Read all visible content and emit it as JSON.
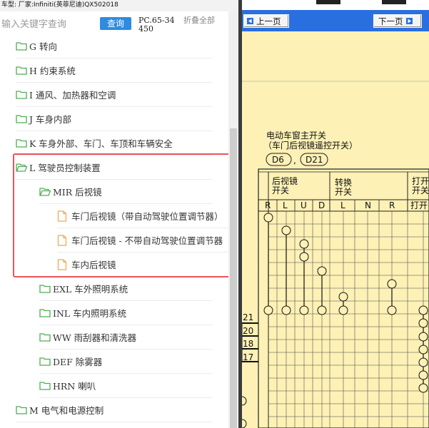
{
  "top_info": "车型:  厂家:Infiniti(英菲尼迪)QX502018",
  "search": {
    "placeholder": "输入关键字查询",
    "button_label": "查询",
    "pc_label": "PC.65-34450",
    "collapse_all": "折叠全部"
  },
  "tree": {
    "items": [
      {
        "label": "G 转向",
        "type": "folder"
      },
      {
        "label": "H 约束系统",
        "type": "folder"
      },
      {
        "label": "I 通风、加热器和空调",
        "type": "folder"
      },
      {
        "label": "J 车身内部",
        "type": "folder"
      },
      {
        "label": "K 车身外部、车门、车顶和车辆安全",
        "type": "folder"
      },
      {
        "label": "L 驾驶员控制装置",
        "type": "folder-open"
      },
      {
        "label": "MIR 后视镜",
        "type": "folder-open"
      },
      {
        "label": "车门后视镜（带自动驾驶位置调节器）",
        "type": "doc"
      },
      {
        "label": "车门后视镜 - 不带自动驾驶位置调节器",
        "type": "doc"
      },
      {
        "label": "车内后视镜",
        "type": "doc"
      },
      {
        "label": "EXL 车外照明系统",
        "type": "folder"
      },
      {
        "label": "INL 车内照明系统",
        "type": "folder"
      },
      {
        "label": "WW 雨刮器和清洗器",
        "type": "folder"
      },
      {
        "label": "DEF 除雾器",
        "type": "folder"
      },
      {
        "label": "HRN 喇叭",
        "type": "folder"
      },
      {
        "label": "M 电气和电源控制",
        "type": "folder"
      }
    ]
  },
  "nav": {
    "prev_label": "上一页",
    "next_label": "下一页"
  },
  "diagram": {
    "title_line1": "电动车窗主开关",
    "title_line2": "（车门后视镜遥控开关）",
    "connector1": "D6",
    "connector_sep": ",",
    "connector2": "D21",
    "header_mirror": [
      "后视镜",
      "开关"
    ],
    "header_change": [
      "转换",
      "开关"
    ],
    "header_open": [
      "打开",
      "开关"
    ],
    "columns": [
      "R",
      "L",
      "U",
      "D",
      "L",
      "N",
      "R",
      "打开"
    ],
    "terminals": [
      "21",
      "20",
      "18",
      "17"
    ]
  },
  "colors": {
    "accent": "#2d8be0",
    "highlight": "#e8545d",
    "folder_green": "#4caf50",
    "nav_blue": "#2a6fe0",
    "diagram_bg": "#fdf1b6"
  }
}
